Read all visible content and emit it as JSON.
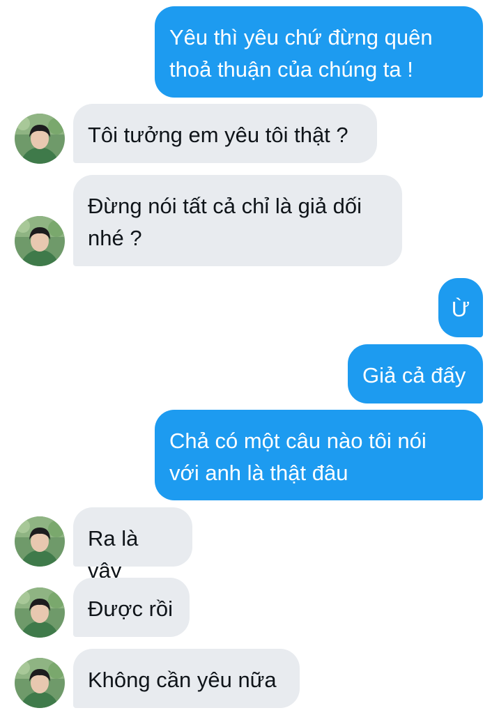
{
  "conversation": {
    "messages": [
      {
        "direction": "outgoing",
        "text": "Yêu thì yêu chứ đừng quên\nthoả thuận của chúng ta !"
      },
      {
        "direction": "incoming",
        "text": "Tôi tưởng em yêu tôi thật ?"
      },
      {
        "direction": "incoming",
        "text": "Đừng nói tất cả chỉ là giả dối\nnhé ?"
      },
      {
        "direction": "outgoing",
        "text": "Ừ"
      },
      {
        "direction": "outgoing",
        "text": "Giả cả đấy"
      },
      {
        "direction": "outgoing",
        "text": "Chả có một câu nào tôi nói\nvới anh là thật đâu"
      },
      {
        "direction": "incoming",
        "text": "Ra là vậy"
      },
      {
        "direction": "incoming",
        "text": "Được rồi"
      },
      {
        "direction": "incoming",
        "text": "Không cần yêu nữa"
      }
    ]
  },
  "colors": {
    "outgoing_bubble": "#1d9bf0",
    "incoming_bubble": "#e8ebef",
    "outgoing_text": "#ffffff",
    "incoming_text": "#0f1419",
    "background": "#ffffff"
  }
}
